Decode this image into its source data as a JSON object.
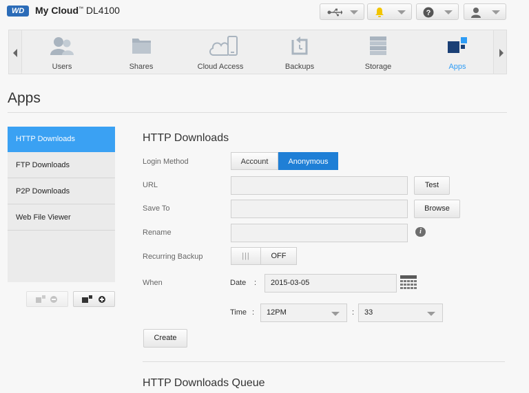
{
  "header": {
    "logo": "WD",
    "brand_prefix": "My Cloud",
    "tm": "™",
    "model": "DL4100",
    "icons": [
      "usb-icon",
      "bell-icon",
      "help-icon",
      "user-icon"
    ]
  },
  "nav": {
    "items": [
      {
        "label": "Users",
        "icon": "users-icon"
      },
      {
        "label": "Shares",
        "icon": "folder-icon"
      },
      {
        "label": "Cloud Access",
        "icon": "cloud-device-icon"
      },
      {
        "label": "Backups",
        "icon": "backup-icon"
      },
      {
        "label": "Storage",
        "icon": "storage-icon"
      },
      {
        "label": "Apps",
        "icon": "apps-icon",
        "active": true
      }
    ]
  },
  "page": {
    "title": "Apps"
  },
  "sidebar": {
    "items": [
      {
        "label": "HTTP Downloads",
        "active": true
      },
      {
        "label": "FTP Downloads"
      },
      {
        "label": "P2P Downloads"
      },
      {
        "label": "Web File Viewer"
      }
    ]
  },
  "form": {
    "title": "HTTP Downloads",
    "login_method_label": "Login Method",
    "login_options": [
      "Account",
      "Anonymous"
    ],
    "login_selected": "Anonymous",
    "url_label": "URL",
    "url_value": "",
    "test_button": "Test",
    "save_to_label": "Save To",
    "save_to_value": "",
    "browse_button": "Browse",
    "rename_label": "Rename",
    "rename_value": "",
    "info_glyph": "i",
    "recurring_label": "Recurring Backup",
    "recurring_grip": "|||",
    "recurring_state": "OFF",
    "when_label": "When",
    "date_label": "Date",
    "date_sep": ":",
    "date_value": "2015-03-05",
    "time_label": "Time",
    "time_sep": ":",
    "hour_value": "12PM",
    "minute_sep": ":",
    "minute_value": "33",
    "create_button": "Create"
  },
  "queue": {
    "title": "HTTP Downloads Queue"
  },
  "colors": {
    "accent": "#3aa1f3",
    "active_button": "#1f7fd6",
    "nav_active_text": "#2e9cf5"
  }
}
